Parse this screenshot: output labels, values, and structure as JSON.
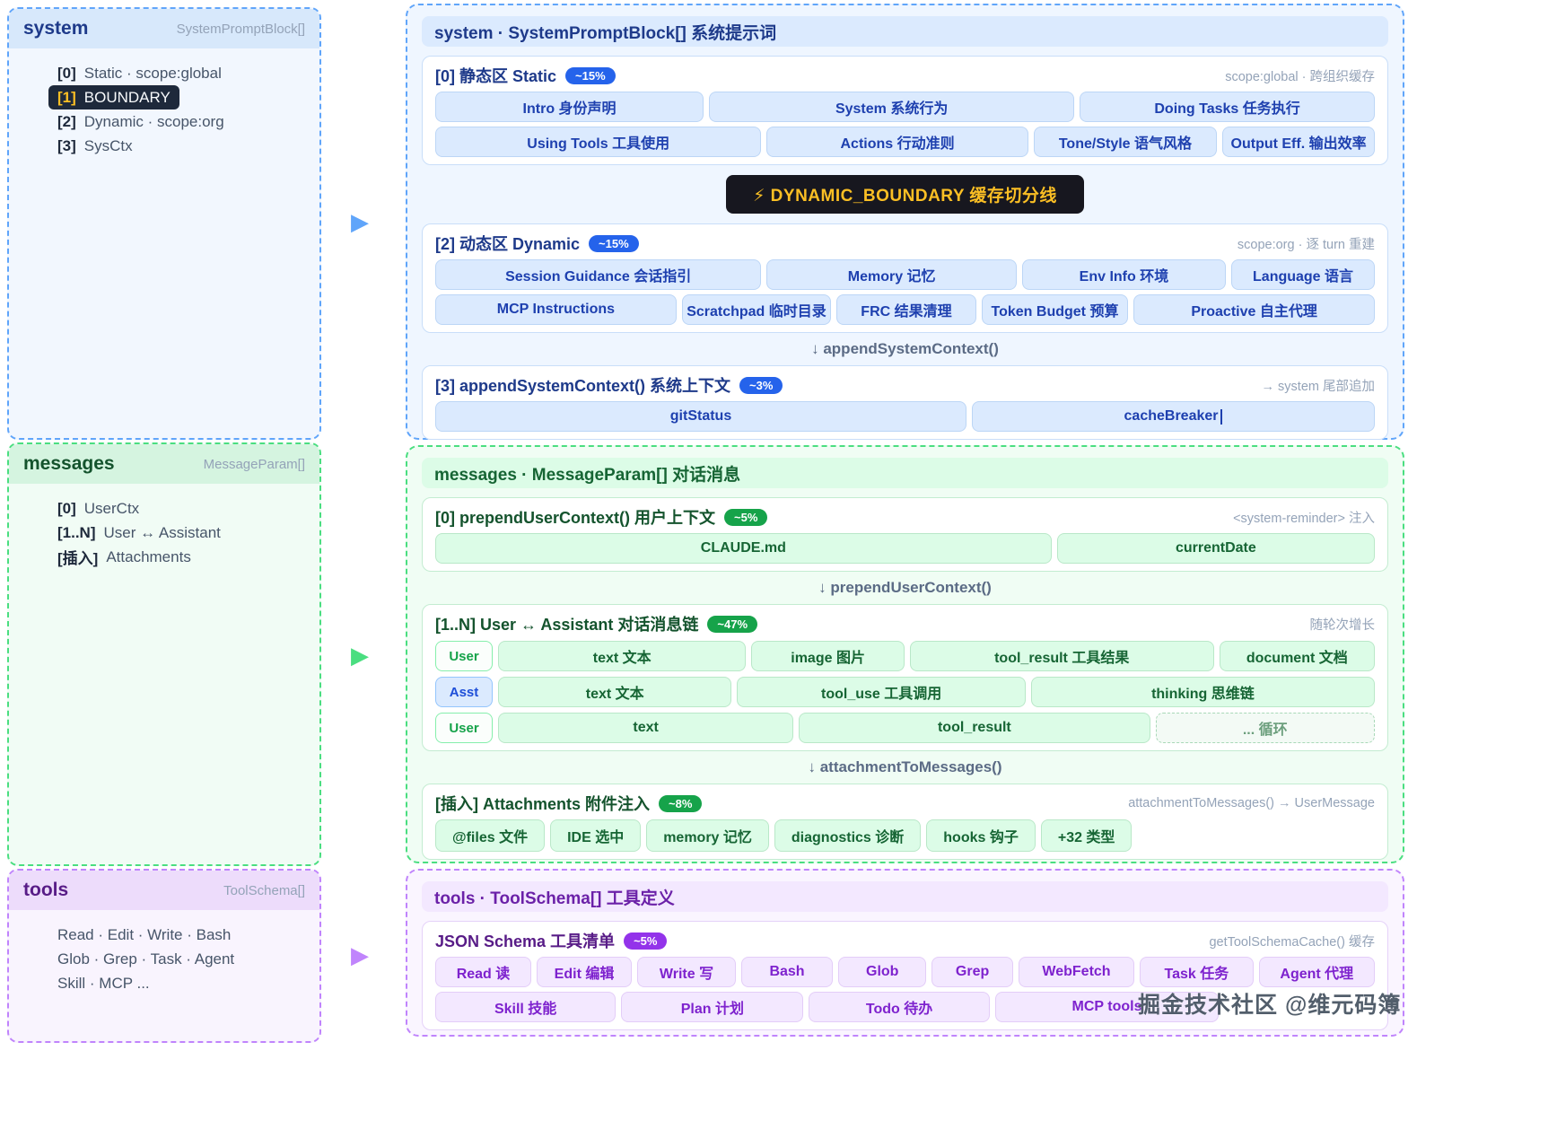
{
  "icons": {
    "flow_arrow": "▶"
  },
  "colors": {
    "accent_blue": "#2563eb",
    "accent_green": "#16a34a",
    "accent_purple": "#9333ea",
    "boundary_bg": "#17171f",
    "boundary_text": "#fbbf24"
  },
  "watermark": "掘金技术社区 @维元码簿",
  "sidebar": {
    "system": {
      "title": "system",
      "type_label": "SystemPromptBlock[]",
      "items": [
        {
          "index": "[0]",
          "label": "Static · scope:global"
        },
        {
          "index": "[1]",
          "label": "BOUNDARY"
        },
        {
          "index": "[2]",
          "label": "Dynamic · scope:org"
        },
        {
          "index": "[3]",
          "label": "SysCtx"
        }
      ]
    },
    "messages": {
      "title": "messages",
      "type_label": "MessageParam[]",
      "items": [
        {
          "index": "[0]",
          "label": "UserCtx"
        },
        {
          "index": "[1..N]",
          "label": "User ↔ Assistant"
        },
        {
          "index": "[插入]",
          "label": "Attachments"
        }
      ]
    },
    "tools": {
      "title": "tools",
      "type_label": "ToolSchema[]",
      "items": [
        {
          "label": "Read · Edit · Write · Bash"
        },
        {
          "label": "Glob · Grep · Task · Agent"
        },
        {
          "label": "Skill · MCP ..."
        }
      ]
    }
  },
  "system_section": {
    "header": "system · SystemPromptBlock[] 系统提示词",
    "static": {
      "title": "[0] 静态区 Static",
      "badge": "~15%",
      "note": "scope:global · 跨组织缓存",
      "row1": [
        "Intro 身份声明",
        "System 系统行为",
        "Doing Tasks 任务执行"
      ],
      "row2": [
        "Using Tools 工具使用",
        "Actions 行动准则",
        "Tone/Style 语气风格",
        "Output Eff. 输出效率"
      ]
    },
    "boundary_banner": "⚡ DYNAMIC_BOUNDARY 缓存切分线",
    "dynamic": {
      "title": "[2] 动态区 Dynamic",
      "badge": "~15%",
      "note": "scope:org · 逐 turn 重建",
      "row1": [
        "Session Guidance 会话指引",
        "Memory 记忆",
        "Env Info 环境",
        "Language 语言"
      ],
      "row2": [
        "MCP Instructions",
        "Scratchpad 临时目录",
        "FRC 结果清理",
        "Token Budget 预算",
        "Proactive 自主代理"
      ]
    },
    "connector": "↓ appendSystemContext()",
    "sysctx": {
      "title": "[3] appendSystemContext() 系统上下文",
      "badge": "~3%",
      "note": "→ system 尾部追加",
      "row1": [
        "gitStatus",
        "cacheBreaker"
      ]
    }
  },
  "messages_section": {
    "header": "messages · MessageParam[] 对话消息",
    "userctx": {
      "title": "[0] prependUserContext() 用户上下文",
      "badge": "~5%",
      "note": "<system-reminder> 注入",
      "row1": [
        "CLAUDE.md",
        "currentDate"
      ]
    },
    "connector1": "↓ prependUserContext()",
    "chain": {
      "title": "[1..N] User ↔ Assistant 对话消息链",
      "badge": "~47%",
      "note": "随轮次增长",
      "rows": [
        {
          "role": "User",
          "chips": [
            "text 文本",
            "image 图片",
            "tool_result 工具结果",
            "document 文档"
          ]
        },
        {
          "role": "Asst",
          "chips": [
            "text 文本",
            "tool_use 工具调用",
            "thinking 思维链"
          ]
        },
        {
          "role": "User",
          "chips": [
            "text",
            "tool_result",
            "... 循环"
          ]
        }
      ]
    },
    "connector2": "↓ attachmentToMessages()",
    "attachments": {
      "title": "[插入] Attachments 附件注入",
      "badge": "~8%",
      "note": "attachmentToMessages() → UserMessage",
      "chips": [
        "@files 文件",
        "IDE 选中",
        "memory 记忆",
        "diagnostics 诊断",
        "hooks 钩子",
        "+32 类型"
      ]
    }
  },
  "tools_section": {
    "header": "tools · ToolSchema[] 工具定义",
    "schema": {
      "title": "JSON Schema 工具清单",
      "badge": "~5%",
      "note": "getToolSchemaCache() 缓存",
      "row1": [
        "Read 读",
        "Edit 编辑",
        "Write 写",
        "Bash",
        "Glob",
        "Grep",
        "WebFetch",
        "Task 任务",
        "Agent 代理"
      ],
      "row2": [
        "Skill 技能",
        "Plan 计划",
        "Todo 待办",
        "MCP tools"
      ]
    }
  }
}
